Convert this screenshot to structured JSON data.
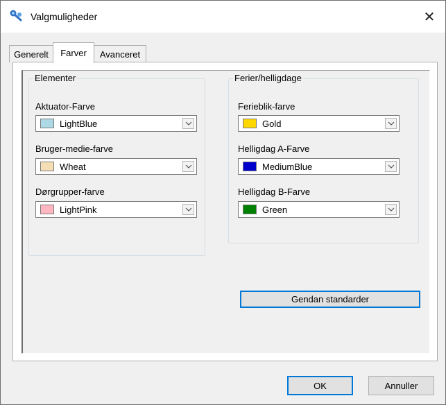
{
  "window": {
    "title": "Valgmuligheder"
  },
  "tabs": [
    {
      "label": "Generelt",
      "active": false
    },
    {
      "label": "Farver",
      "active": true
    },
    {
      "label": "Avanceret",
      "active": false
    }
  ],
  "groups": {
    "elementer": {
      "legend": "Elementer",
      "fields": [
        {
          "label": "Aktuator-Farve",
          "value": "LightBlue",
          "color": "#add8e6"
        },
        {
          "label": "Bruger-medie-farve",
          "value": "Wheat",
          "color": "#f5deb3"
        },
        {
          "label": "Dørgrupper-farve",
          "value": "LightPink",
          "color": "#ffb6c1"
        }
      ]
    },
    "ferier": {
      "legend": "Ferier/helligdage",
      "fields": [
        {
          "label": "Ferieblik-farve",
          "value": "Gold",
          "color": "#ffd700"
        },
        {
          "label": "Helligdag A-Farve",
          "value": "MediumBlue",
          "color": "#0000cd"
        },
        {
          "label": "Helligdag B-Farve",
          "value": "Green",
          "color": "#008000"
        }
      ]
    }
  },
  "buttons": {
    "reset": "Gendan standarder",
    "ok": "OK",
    "cancel": "Annuller"
  },
  "icons": {
    "app": "app-icon",
    "close": "close-icon",
    "dropdown": "chevron-down-icon"
  }
}
